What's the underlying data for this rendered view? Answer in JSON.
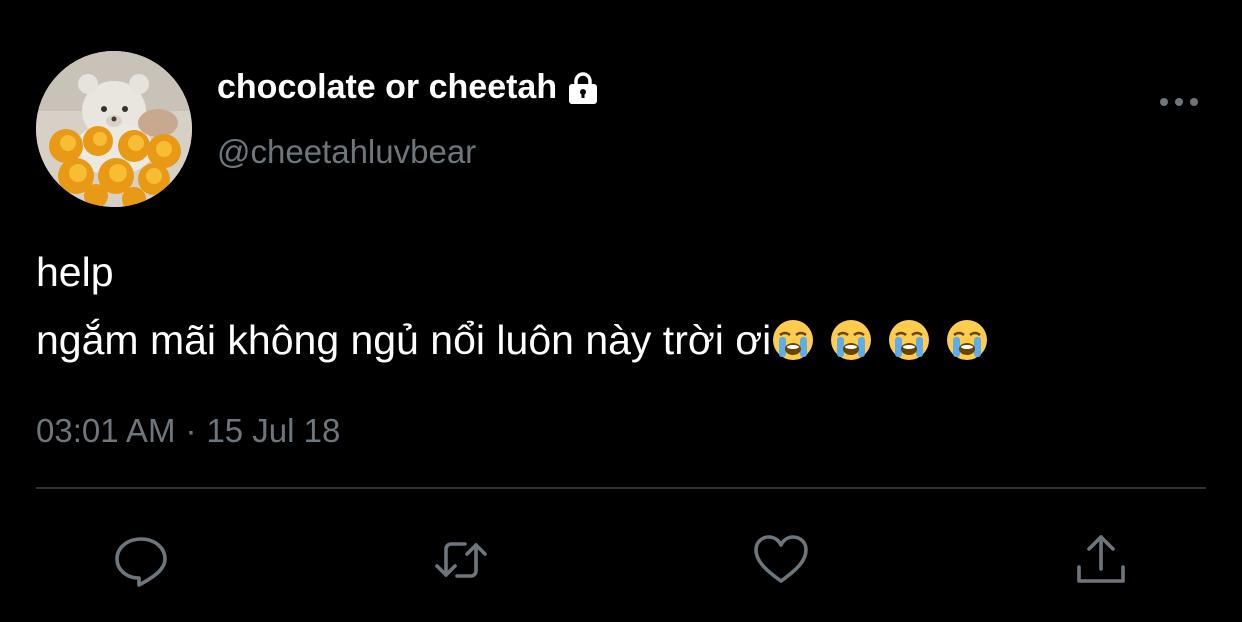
{
  "tweet": {
    "display_name": "chocolate or cheetah",
    "handle": "@cheetahluvbear",
    "protected_icon": "lock-icon",
    "text_lines": [
      "help",
      "ngắm mãi không ngủ nổi luôn này trời ơi"
    ],
    "emojis": [
      "loudly-crying-face",
      "loudly-crying-face",
      "loudly-crying-face",
      "loudly-crying-face"
    ],
    "time": "03:01 AM",
    "separator": "·",
    "date": "15 Jul 18"
  },
  "actions": [
    {
      "name": "reply",
      "icon": "reply-icon"
    },
    {
      "name": "retweet",
      "icon": "retweet-icon"
    },
    {
      "name": "like",
      "icon": "heart-icon"
    },
    {
      "name": "share",
      "icon": "share-icon"
    }
  ],
  "colors": {
    "background": "#000000",
    "text": "#ffffff",
    "secondary": "#6e767d",
    "divider": "#2f3336"
  }
}
